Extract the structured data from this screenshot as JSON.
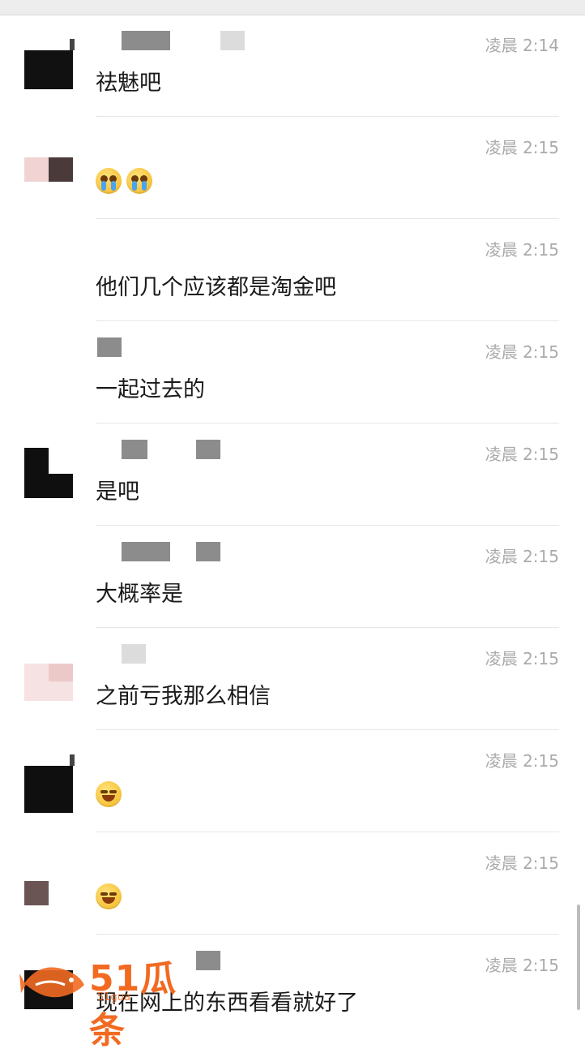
{
  "messages": [
    {
      "time": "凌晨 2:14",
      "text": "祛魅吧",
      "emoji_count": 0
    },
    {
      "time": "凌晨 2:15",
      "text": "",
      "emoji_count": 2
    },
    {
      "time": "凌晨 2:15",
      "text": "他们几个应该都是淘金吧",
      "emoji_count": 0
    },
    {
      "time": "凌晨 2:15",
      "text": "一起过去的",
      "emoji_count": 0
    },
    {
      "time": "凌晨 2:15",
      "text": "是吧",
      "emoji_count": 0
    },
    {
      "time": "凌晨 2:15",
      "text": "大概率是",
      "emoji_count": 0
    },
    {
      "time": "凌晨 2:15",
      "text": "之前亏我那么相信",
      "emoji_count": 0
    },
    {
      "time": "凌晨 2:15",
      "text": "",
      "emoji_count": 1
    },
    {
      "time": "凌晨 2:15",
      "text": "",
      "emoji_count": 1
    },
    {
      "time": "凌晨 2:15",
      "text": "现在网上的东西看看就好了",
      "emoji_count": 0
    }
  ],
  "icons": {
    "crying_emoji": "crying-face-icon",
    "laughing_emoji": "tears-of-joy-icon"
  },
  "watermark": {
    "brand": "51瓜条",
    "site": "51gua"
  },
  "colors": {
    "time": "#aaaaaa",
    "text": "#1a1a1a",
    "watermark": "#f26a22"
  }
}
